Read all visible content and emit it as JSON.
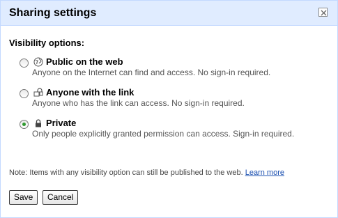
{
  "dialog": {
    "title": "Sharing settings",
    "close_icon": "close-icon"
  },
  "visibility": {
    "label": "Visibility options:",
    "options": [
      {
        "title": "Public on the web",
        "description": "Anyone on the Internet can find and access. No sign-in required.",
        "icon": "globe-icon",
        "selected": false
      },
      {
        "title": "Anyone with the link",
        "description": "Anyone who has the link can access. No sign-in required.",
        "icon": "link-icon",
        "selected": false
      },
      {
        "title": "Private",
        "description": "Only people explicitly granted permission can access. Sign-in required.",
        "icon": "lock-icon",
        "selected": true
      }
    ]
  },
  "note": {
    "text": "Note: Items with any visibility option can still be published to the web.",
    "link": "Learn more"
  },
  "buttons": {
    "save": "Save",
    "cancel": "Cancel"
  },
  "colors": {
    "header_bg": "#e0ecff",
    "border": "#c3d9ff",
    "link": "#1a4fb0",
    "radio_selected": "#2e9a2e"
  }
}
